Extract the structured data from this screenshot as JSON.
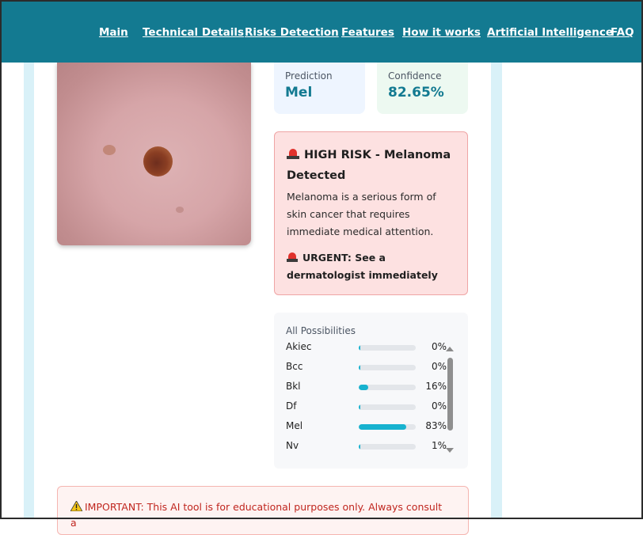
{
  "nav": {
    "items": [
      "Main",
      "Technical Details",
      "Risks Detection",
      "Features",
      "How it works",
      "Artificial Intelligence",
      "FAQ"
    ]
  },
  "result": {
    "prediction_label": "Prediction",
    "prediction_value": "Mel",
    "confidence_label": "Confidence",
    "confidence_value": "82.65%"
  },
  "risk": {
    "title": "HIGH RISK - Melanoma Detected",
    "description": "Melanoma is a serious form of skin cancer that requires immediate medical attention.",
    "urgent": "URGENT: See a dermatologist immediately",
    "icon": "siren-icon"
  },
  "possibilities": {
    "title": "All Possibilities",
    "items": [
      {
        "name": "Akiec",
        "pct": "0%",
        "value": 0
      },
      {
        "name": "Bcc",
        "pct": "0%",
        "value": 0
      },
      {
        "name": "Bkl",
        "pct": "16%",
        "value": 16
      },
      {
        "name": "Df",
        "pct": "0%",
        "value": 0
      },
      {
        "name": "Mel",
        "pct": "83%",
        "value": 83
      },
      {
        "name": "Nv",
        "pct": "1%",
        "value": 1
      }
    ]
  },
  "disclaimer": {
    "text": "IMPORTANT: This AI tool is for educational purposes only. Always consult a"
  },
  "colors": {
    "navbar": "#137a91",
    "accent": "#17b2cf",
    "danger_bg": "#fde1e1",
    "danger_text": "#c0261f"
  }
}
